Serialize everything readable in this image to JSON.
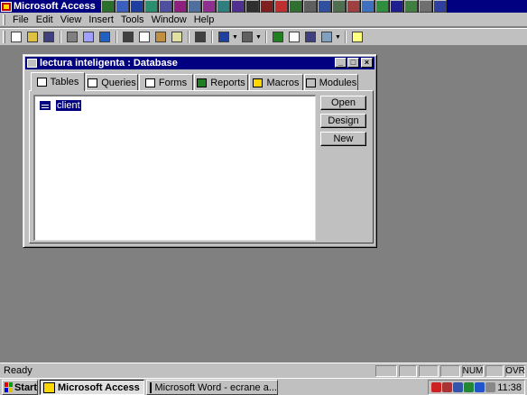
{
  "app": {
    "title": "Microsoft Access"
  },
  "quicklaunch": {
    "colors": [
      "#2a6f2a",
      "#3a5fbf",
      "#1f3fa0",
      "#2a8f6f",
      "#4f4f9f",
      "#8f1f7f",
      "#4f6f9f",
      "#8f2f8f",
      "#2f7f7f",
      "#4f2f8f",
      "#2f2f2f",
      "#7f1f1f",
      "#bf2f2f",
      "#2f6f2f",
      "#5f5f5f",
      "#2f4f9f",
      "#4f6f4f",
      "#9f3f3f",
      "#3f6fbf",
      "#2f8f3f",
      "#1f1f8f",
      "#3f7f3f",
      "#6f6f6f",
      "#2f3f9f"
    ]
  },
  "menu": [
    "File",
    "Edit",
    "View",
    "Insert",
    "Tools",
    "Window",
    "Help"
  ],
  "toolbar": {
    "icons": [
      "new-icon",
      "open-icon",
      "save-icon",
      "|",
      "print-icon",
      "print-preview-icon",
      "spelling-icon",
      "|",
      "cut-icon",
      "copy-icon",
      "paste-icon",
      "format-painter-icon",
      "|",
      "undo-icon",
      "|",
      "office-links-icon",
      "v",
      "analyze-icon",
      "v",
      "|",
      "code-icon",
      "properties-icon",
      "relationships-icon",
      "new-object-icon",
      "v",
      "|",
      "help-icon"
    ]
  },
  "db_window": {
    "title": "lectura inteligenta : Database",
    "tabs": [
      {
        "label": "Tables",
        "icon": "tables-icon"
      },
      {
        "label": "Queries",
        "icon": "queries-icon"
      },
      {
        "label": "Forms",
        "icon": "forms-icon"
      },
      {
        "label": "Reports",
        "icon": "reports-icon"
      },
      {
        "label": "Macros",
        "icon": "macros-icon"
      },
      {
        "label": "Modules",
        "icon": "modules-icon"
      }
    ],
    "items": [
      {
        "label": "client",
        "selected": true
      }
    ],
    "buttons": {
      "open": "Open",
      "design": "Design",
      "new": "New"
    }
  },
  "status": {
    "text": "Ready",
    "num": "NUM",
    "ovr": "OVR"
  },
  "taskbar": {
    "start": "Start",
    "tasks": [
      {
        "label": "Microsoft Access",
        "active": true
      },
      {
        "label": "Microsoft Word - ecrane a...",
        "active": false
      }
    ],
    "tray_colors": [
      "#cc2222",
      "#aa3333",
      "#3355aa",
      "#228833",
      "#2255cc",
      "#888888"
    ],
    "clock": "11:38"
  },
  "colors": {
    "titlebar": "#000080",
    "face": "#c0c0c0",
    "desktop": "#808080",
    "selection": "#000080"
  }
}
